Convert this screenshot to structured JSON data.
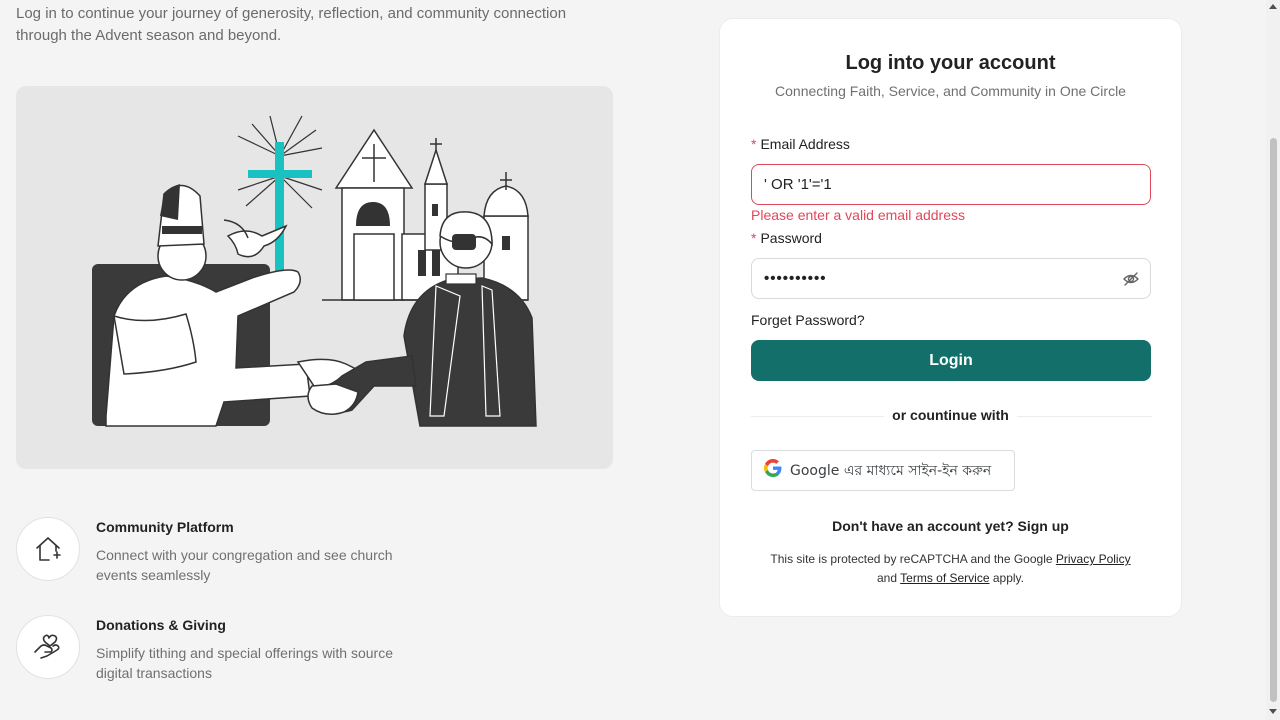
{
  "intro": {
    "text": "Log in to continue your journey of generosity, reflection, and community connection through the Advent season and beyond."
  },
  "features": [
    {
      "icon": "house-plus-icon",
      "title": "Community Platform",
      "description": "Connect with your congregation and see church events seamlessly"
    },
    {
      "icon": "hand-heart-icon",
      "title": "Donations & Giving",
      "description": "Simplify tithing and special offerings with source digital transactions"
    }
  ],
  "login": {
    "title": "Log into your account",
    "subtitle": "Connecting Faith, Service, and Community in One Circle",
    "email_label": "Email Address",
    "email_value": "' OR '1'='1",
    "email_error": "Please enter a valid email address",
    "password_label": "Password",
    "password_value": "••••••••••",
    "forgot_label": "Forget Password?",
    "login_button": "Login",
    "divider_text": "or countinue with",
    "google_button": "Google এর মাধ্যমে সাইন-ইন করুন",
    "signup_prompt": "Don't have an account yet?",
    "signup_link": "Sign up",
    "legal_prefix": "This site is protected by reCAPTCHA and the Google",
    "privacy_link": "Privacy Policy",
    "legal_and": "and",
    "terms_link": "Terms of Service",
    "legal_suffix": "apply."
  },
  "colors": {
    "primary": "#136f6a",
    "error": "#e0475a",
    "background": "#f4f4f4",
    "accent_cross": "#19c2c0"
  }
}
